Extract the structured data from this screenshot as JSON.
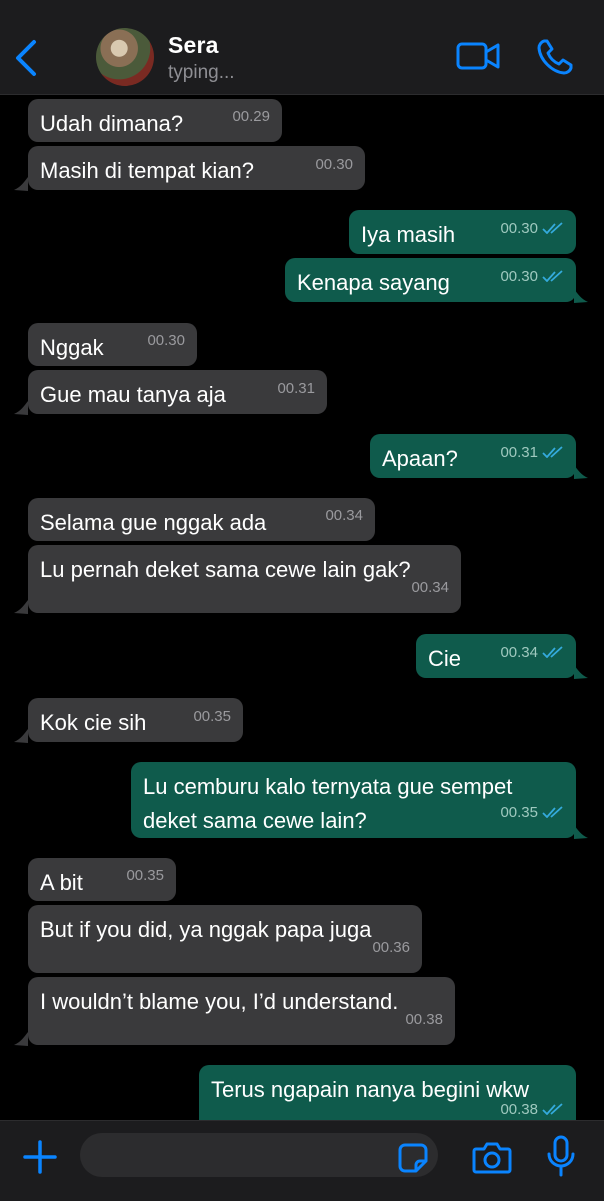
{
  "header": {
    "contact_name": "Sera",
    "status": "typing...",
    "icons": {
      "back": "chevron-left-icon",
      "video": "video-camera-icon",
      "call": "phone-icon"
    }
  },
  "messages": [
    {
      "direction": "in",
      "text": "Udah dimana?",
      "time": "00.29"
    },
    {
      "direction": "in",
      "text": "Masih di tempat kian?",
      "time": "00.30"
    },
    {
      "direction": "out",
      "text": "Iya masih",
      "time": "00.30",
      "read": true
    },
    {
      "direction": "out",
      "text": "Kenapa sayang",
      "time": "00.30",
      "read": true
    },
    {
      "direction": "in",
      "text": "Nggak",
      "time": "00.30"
    },
    {
      "direction": "in",
      "text": "Gue mau tanya aja",
      "time": "00.31"
    },
    {
      "direction": "out",
      "text": "Apaan?",
      "time": "00.31",
      "read": true
    },
    {
      "direction": "in",
      "text": "Selama gue nggak ada",
      "time": "00.34"
    },
    {
      "direction": "in",
      "text": "Lu pernah deket sama cewe lain gak?",
      "time": "00.34"
    },
    {
      "direction": "out",
      "text": "Cie",
      "time": "00.34",
      "read": true
    },
    {
      "direction": "in",
      "text": "Kok cie sih",
      "time": "00.35"
    },
    {
      "direction": "out",
      "text": "Lu cemburu kalo ternyata gue sempet deket sama cewe lain?",
      "time": "00.35",
      "read": true
    },
    {
      "direction": "in",
      "text": "A bit",
      "time": "00.35"
    },
    {
      "direction": "in",
      "text": "But if you did, ya nggak papa juga",
      "time": "00.36"
    },
    {
      "direction": "in",
      "text": "I wouldn’t blame you, I’d understand.",
      "time": "00.38"
    },
    {
      "direction": "out",
      "text": "Terus ngapain nanya begini wkw",
      "time": "00.38",
      "read": true
    }
  ],
  "composer": {
    "value": "",
    "icons": {
      "attach": "plus-icon",
      "sticker": "sticker-icon",
      "camera": "camera-icon",
      "mic": "microphone-icon"
    }
  },
  "colors": {
    "background": "#000000",
    "incoming_bubble": "#3a3a3c",
    "outgoing_bubble": "#0f5b4c",
    "accent": "#0a84ff",
    "read_tick": "#34aadc"
  }
}
